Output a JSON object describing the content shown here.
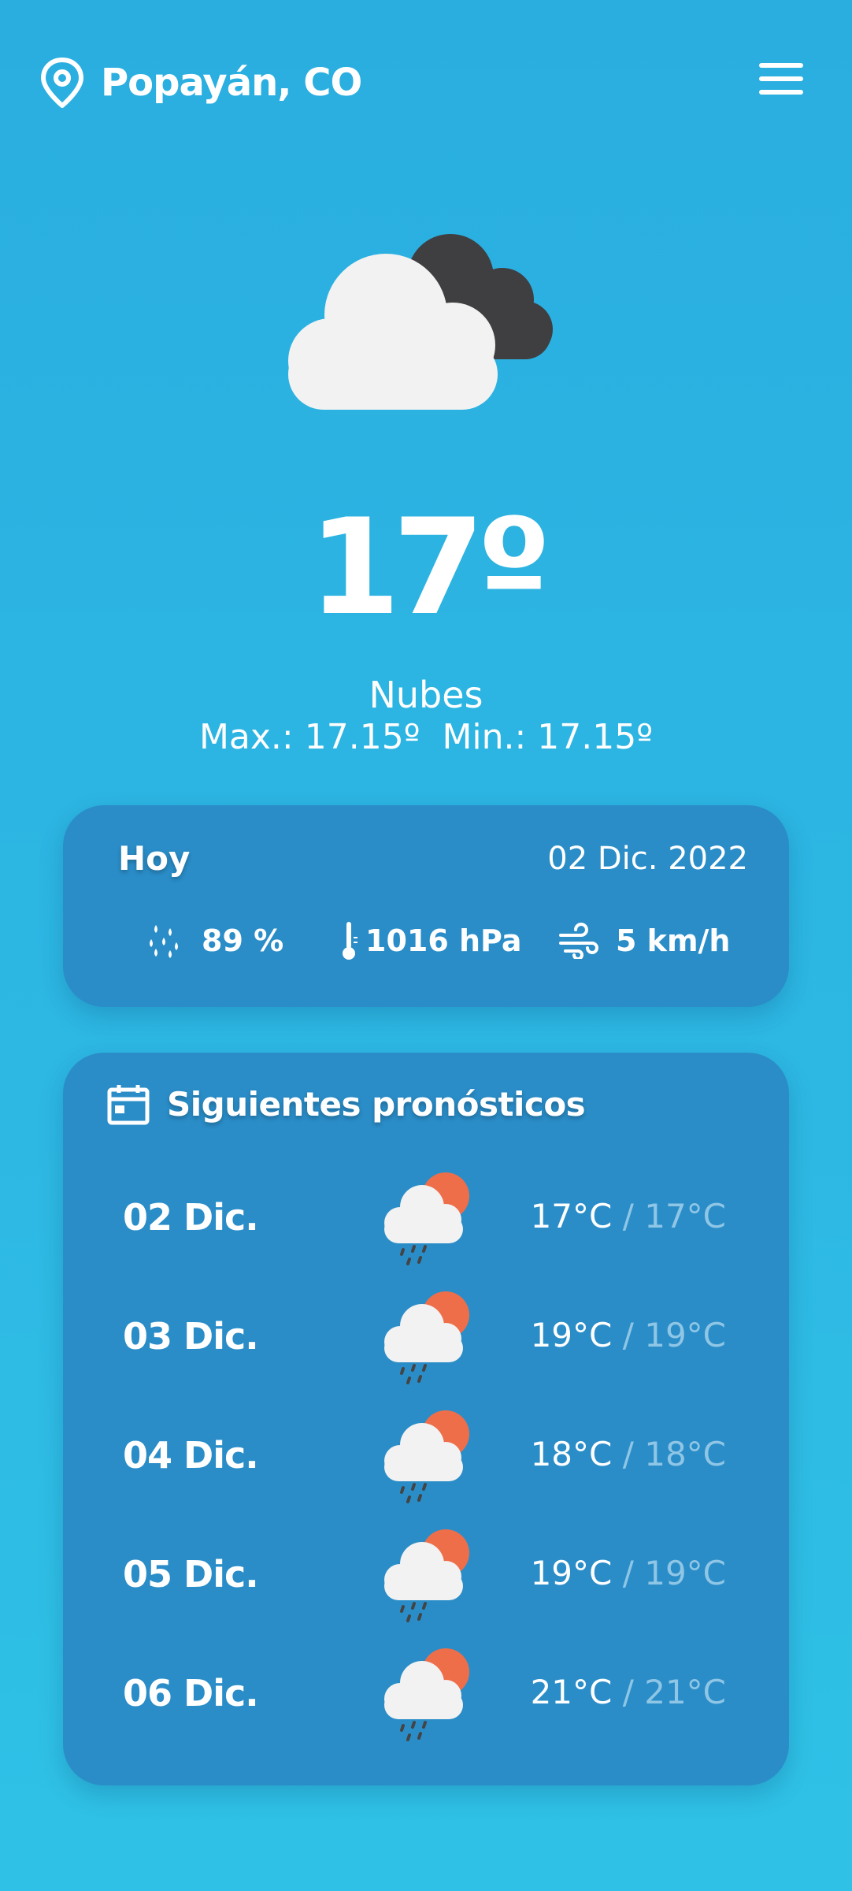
{
  "header": {
    "city": "Popayán, CO",
    "location_icon": "map-pin-icon",
    "menu_icon": "hamburger-menu-icon"
  },
  "current": {
    "icon": "cloudy-icon",
    "temperature": "17º",
    "condition": "Nubes",
    "max": "Max.: 17.15º",
    "min": "Min.: 17.15º"
  },
  "today": {
    "label": "Hoy",
    "date": "02 Dic. 2022",
    "humidity": "89 %",
    "pressure": "1016 hPa",
    "wind": "5 km/h"
  },
  "forecast": {
    "title": "Siguientes pronósticos",
    "icon": "calendar-icon",
    "days": [
      {
        "day": "02 Dic.",
        "high": "17°C",
        "sep": "/",
        "low": "17°C",
        "icon": "rain-sun-icon"
      },
      {
        "day": "03 Dic.",
        "high": "19°C",
        "sep": "/",
        "low": "19°C",
        "icon": "rain-sun-icon"
      },
      {
        "day": "04 Dic.",
        "high": "18°C",
        "sep": "/",
        "low": "18°C",
        "icon": "rain-sun-icon"
      },
      {
        "day": "05 Dic.",
        "high": "19°C",
        "sep": "/",
        "low": "19°C",
        "icon": "rain-sun-icon"
      },
      {
        "day": "06 Dic.",
        "high": "21°C",
        "sep": "/",
        "low": "21°C",
        "icon": "rain-sun-icon"
      }
    ]
  },
  "colors": {
    "background": "#2aaee0",
    "card": "#2a8dc8",
    "sun": "#ee6e4a",
    "dark_cloud": "#3f3f41",
    "light_cloud": "#f2f2f2"
  }
}
